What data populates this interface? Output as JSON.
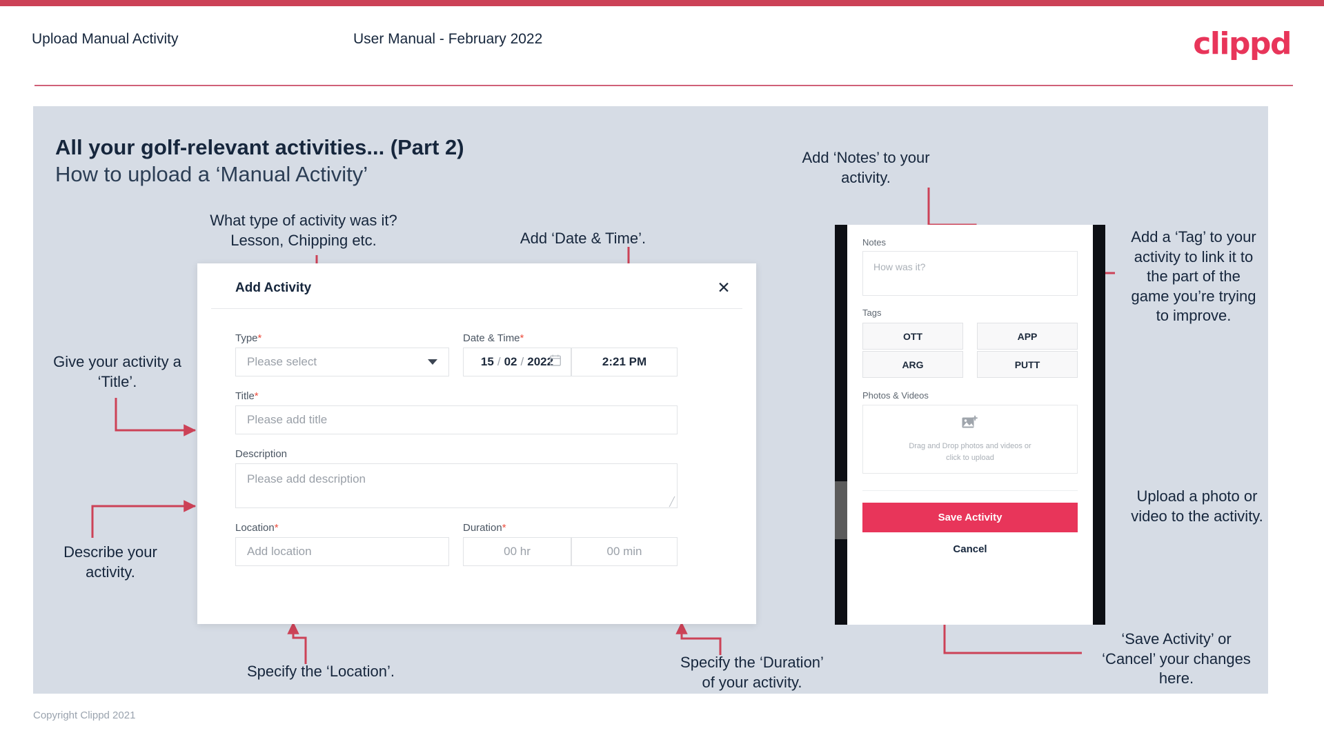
{
  "header": {
    "title": "Upload Manual Activity",
    "subtitle": "User Manual - February 2022",
    "logo": "clippd"
  },
  "slide": {
    "title": "All your golf-relevant activities... (Part 2)",
    "subtitle": "How to upload a ‘Manual Activity’"
  },
  "callouts": {
    "type": "What type of activity was it?\nLesson, Chipping etc.",
    "type_line1": "What type of activity was it?",
    "type_line2": "Lesson, Chipping etc.",
    "datetime": "Add ‘Date & Time’.",
    "notes_line1": "Add ‘Notes’ to your",
    "notes_line2": "activity.",
    "tag_line1": "Add a ‘Tag’ to your",
    "tag_line2": "activity to link it to",
    "tag_line3": "the part of the",
    "tag_line4": "game you’re trying",
    "tag_line5": "to improve.",
    "title_line1": "Give your activity a",
    "title_line2": "‘Title’.",
    "describe_line1": "Describe your",
    "describe_line2": "activity.",
    "upload_line1": "Upload a photo or",
    "upload_line2": "video to the activity.",
    "location": "Specify the ‘Location’.",
    "duration_line1": "Specify the ‘Duration’",
    "duration_line2": "of your activity.",
    "save_line1": "‘Save Activity’ or",
    "save_line2": "‘Cancel’ your changes",
    "save_line3": "here."
  },
  "dialog": {
    "title": "Add Activity",
    "close_label": "✕",
    "fields": {
      "type_label": "Type",
      "type_placeholder": "Please select",
      "datetime_label": "Date & Time",
      "date_day": "15",
      "date_month": "02",
      "date_year": "2022",
      "date_sep": "/",
      "time_value": "2:21 PM",
      "title_label": "Title",
      "title_placeholder": "Please add title",
      "description_label": "Description",
      "description_placeholder": "Please add description",
      "location_label": "Location",
      "location_placeholder": "Add location",
      "duration_label": "Duration",
      "duration_hr_placeholder": "00 hr",
      "duration_min_placeholder": "00 min"
    },
    "required_marker": "*"
  },
  "phone": {
    "notes_label": "Notes",
    "notes_placeholder": "How was it?",
    "tags_label": "Tags",
    "tags": [
      "OTT",
      "APP",
      "ARG",
      "PUTT"
    ],
    "photos_label": "Photos & Videos",
    "drop_line1": "Drag and Drop photos and videos or",
    "drop_line2": "click to upload",
    "save_label": "Save Activity",
    "cancel_label": "Cancel"
  },
  "footer": {
    "copyright": "Copyright Clippd 2021"
  },
  "colors": {
    "brand_pink": "#e8355a",
    "top_bar": "#cc4257",
    "slide_bg": "#d6dce5",
    "arrow": "#cc4257",
    "text_dark": "#16263c"
  }
}
